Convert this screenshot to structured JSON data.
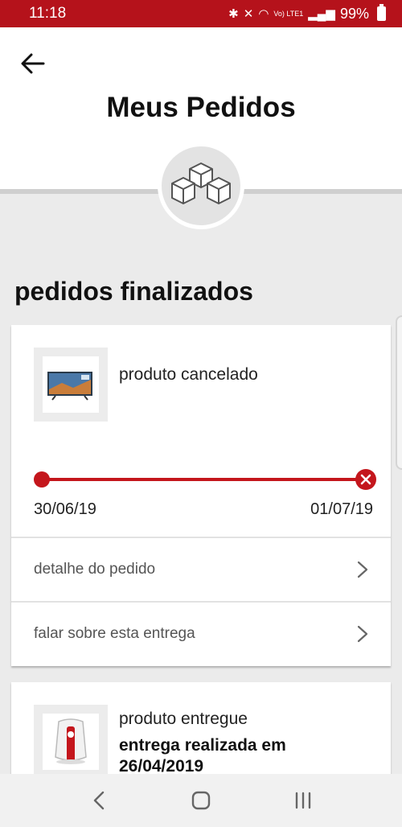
{
  "status_bar": {
    "time": "11:18",
    "battery": "99%",
    "net_label": "Vo) LTE1"
  },
  "header": {
    "title": "Meus Pedidos"
  },
  "section": {
    "title": "pedidos finalizados"
  },
  "orders": [
    {
      "status": "produto cancelado",
      "start_date": "30/06/19",
      "end_date": "01/07/19",
      "links": [
        "detalhe do pedido",
        "falar sobre esta entrega"
      ]
    },
    {
      "status": "produto entregue",
      "delivery_text": "entrega realizada em 26/04/2019"
    }
  ],
  "colors": {
    "brand_red": "#b5121b",
    "track_red": "#c4161c"
  },
  "icons": [
    "back-arrow-icon",
    "boxes-icon",
    "chevron-right-icon",
    "cancel-icon",
    "nav-back-icon",
    "nav-home-icon",
    "nav-recents-icon"
  ]
}
